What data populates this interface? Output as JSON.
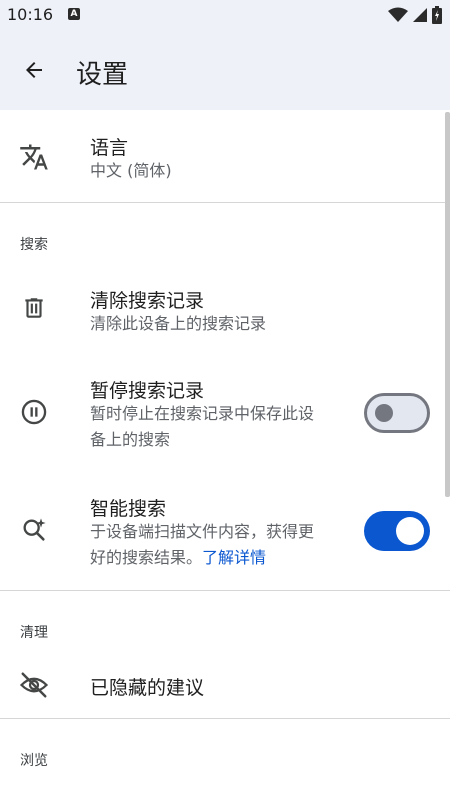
{
  "status": {
    "time": "10:16",
    "a_badge": "A"
  },
  "header": {
    "title": "设置"
  },
  "language": {
    "title": "语言",
    "value": "中文 (简体)"
  },
  "search_section": {
    "header": "搜索",
    "clear": {
      "title": "清除搜索记录",
      "subtitle": "清除此设备上的搜索记录"
    },
    "pause": {
      "title": "暂停搜索记录",
      "subtitle_line1": "暂时停止在搜索记录中保存此设",
      "subtitle_line2": "备上的搜索",
      "enabled": false
    },
    "smart": {
      "title": "智能搜索",
      "subtitle_line1": "于设备端扫描文件内容，获得更",
      "subtitle_line2": "好的搜索结果。",
      "link": "了解详情",
      "enabled": true
    }
  },
  "clean_section": {
    "header": "清理",
    "hidden_suggestions": "已隐藏的建议"
  },
  "browse_section": {
    "header": "浏览"
  },
  "colors": {
    "accent": "#0b57d0",
    "header_bg": "#eef1f8"
  }
}
